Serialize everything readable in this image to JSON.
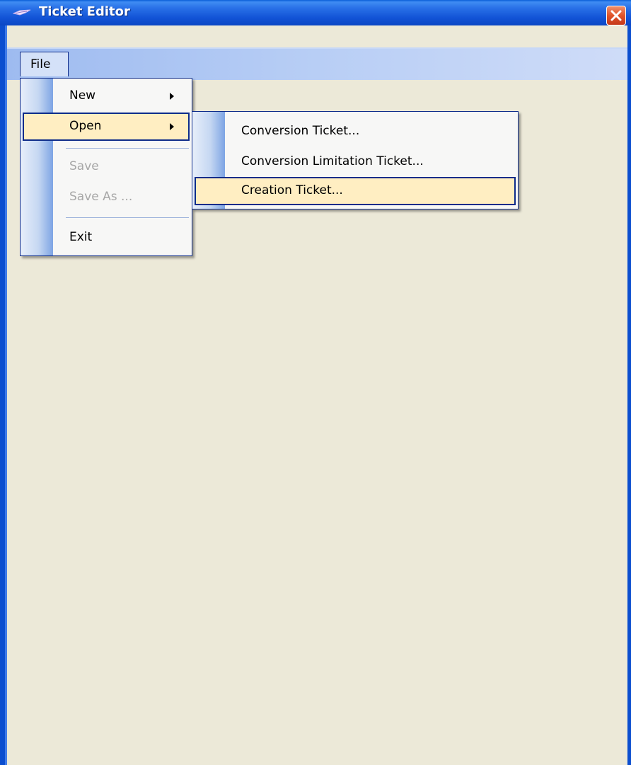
{
  "window": {
    "title": "Ticket Editor",
    "colors": {
      "titlebar": "#1253d6",
      "close": "#e0542a",
      "menu_highlight": "#ffeec2",
      "client": "#ece9d8"
    }
  },
  "menubar": {
    "file_label": "File"
  },
  "file_menu": {
    "items": [
      {
        "label": "New",
        "has_submenu": true,
        "enabled": true
      },
      {
        "label": "Open",
        "has_submenu": true,
        "enabled": true,
        "highlighted": true
      },
      {
        "label": "Save",
        "enabled": false
      },
      {
        "label": "Save As ...",
        "enabled": false
      },
      {
        "label": "Exit",
        "enabled": true
      }
    ]
  },
  "open_submenu": {
    "items": [
      {
        "label": "Conversion Ticket..."
      },
      {
        "label": "Conversion Limitation Ticket..."
      },
      {
        "label": "Creation Ticket...",
        "highlighted": true
      }
    ]
  },
  "icons": [
    "app-icon",
    "close-icon",
    "submenu-arrow-icon"
  ]
}
